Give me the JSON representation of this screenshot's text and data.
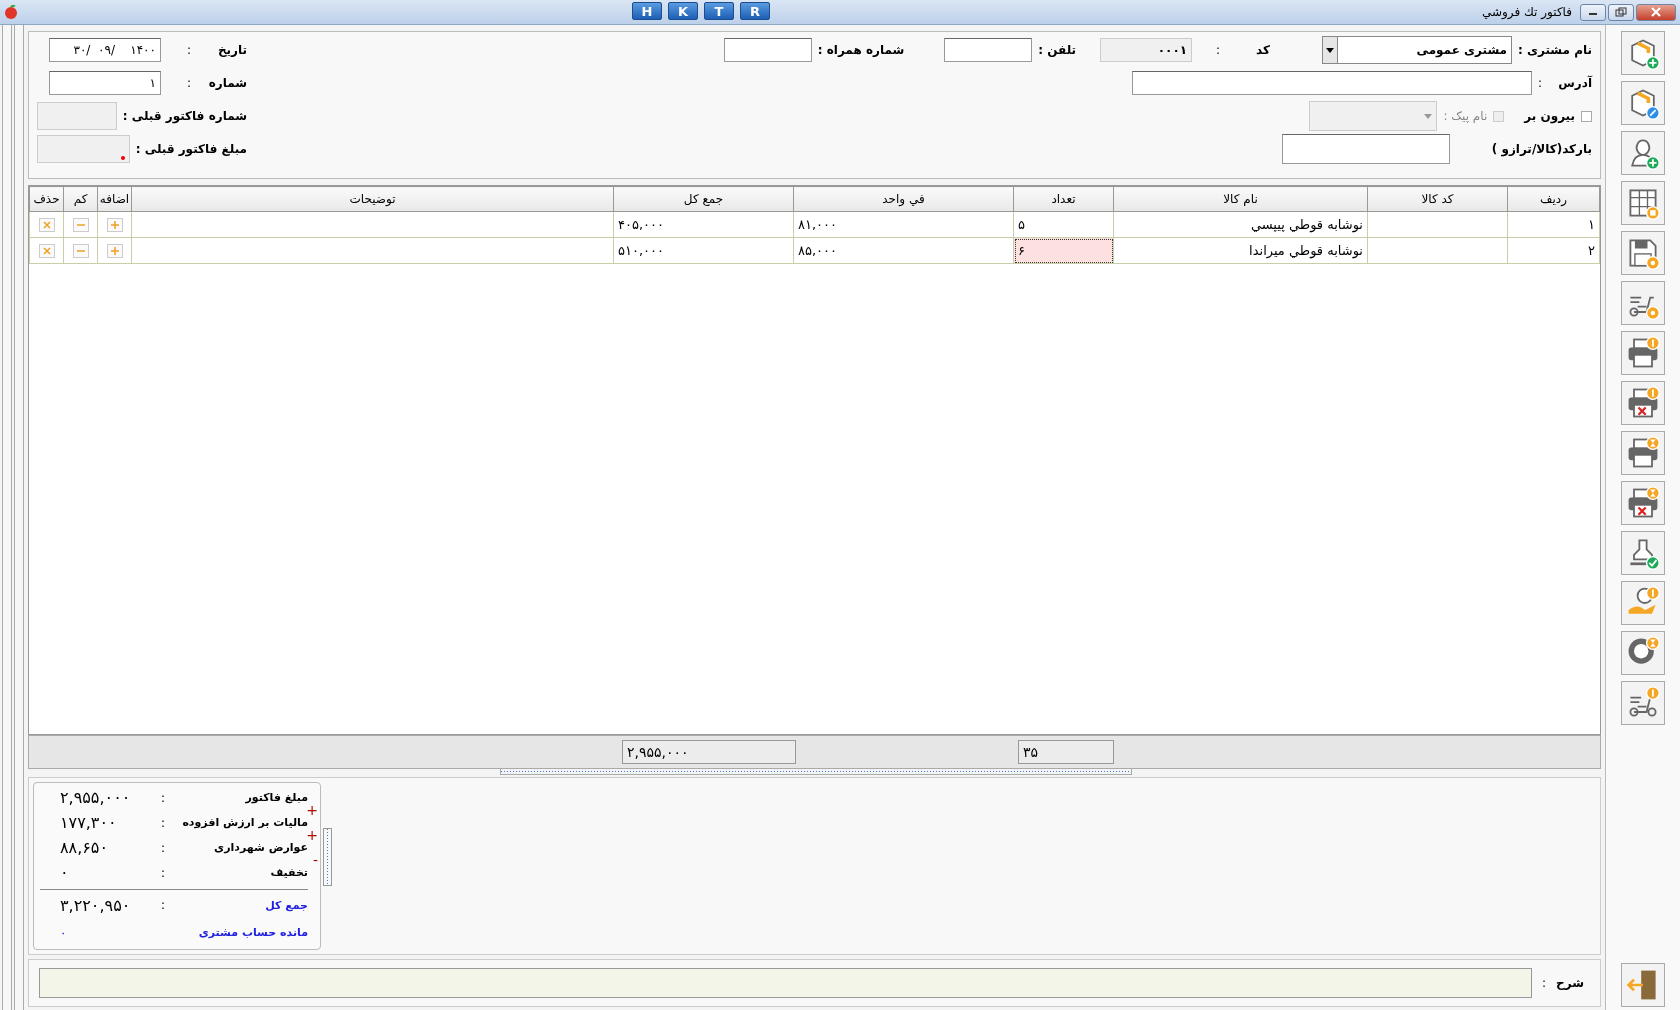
{
  "window": {
    "title": "فاکتور تك فروشي",
    "buttons": [
      "R",
      "T",
      "K",
      "H"
    ]
  },
  "form": {
    "customer": {
      "label": "نام مشتری :",
      "value": "مشتری عمومی"
    },
    "code": {
      "label": "کد",
      "colon": ":",
      "value": "۰۰۰۱"
    },
    "phone": {
      "label": "تلفن :"
    },
    "mobile": {
      "label": "شماره همراه :"
    },
    "date": {
      "label": "تاریخ",
      "colon": ":",
      "value": "۱۴۰۰    /۰۹  /۳۰"
    },
    "number": {
      "label": "شماره",
      "colon": ":",
      "value": "۱"
    },
    "address": {
      "label": "آدرس",
      "colon": ":"
    },
    "takeaway": {
      "label": "بیرون بر",
      "checked": false
    },
    "courier": {
      "label": "نام پیک :",
      "checked": false,
      "disabled": true
    },
    "prev_invoice_no": {
      "label": "شماره فاکتور قبلی :"
    },
    "prev_invoice_amount": {
      "label": "مبلغ فاکتور قبلی :"
    },
    "barcode": {
      "label": "بارکد(کالا/ترازو )"
    }
  },
  "table": {
    "columns": [
      "ردیف",
      "کد کالا",
      "نام کالا",
      "تعداد",
      "في واحد",
      "جمع کل",
      "توضیحات",
      "اضافه",
      "کم",
      "حذف"
    ],
    "rows": [
      {
        "index": "۱",
        "code": "",
        "name": "نوشابه قوطي پيپسي",
        "qty": "۵",
        "unit_price": "۸۱,۰۰۰",
        "total": "۴۰۵,۰۰۰",
        "selected": false
      },
      {
        "index": "۲",
        "code": "",
        "name": "نوشابه قوطي ميراندا",
        "qty": "۶",
        "unit_price": "۸۵,۰۰۰",
        "total": "۵۱۰,۰۰۰",
        "selected": true
      }
    ],
    "footer": {
      "qty": "۳۵",
      "total": "۲,۹۵۵,۰۰۰"
    }
  },
  "summary": [
    {
      "label": "مبلغ فاکتور",
      "colon": ":",
      "value": "۲,۹۵۵,۰۰۰",
      "kind": "line"
    },
    {
      "label": "ماليات بر ارزش افزوده",
      "colon": ":",
      "value": "۱۷۷,۳۰۰",
      "kind": "line",
      "sign": "+"
    },
    {
      "label": "عوارض شهرداری",
      "colon": ":",
      "value": "۸۸,۶۵۰",
      "kind": "line",
      "sign": "+"
    },
    {
      "label": "تخفيف",
      "colon": ":",
      "value": "۰",
      "kind": "line",
      "sign": "-"
    },
    {
      "label": "جمع کل",
      "colon": ":",
      "value": "۳,۲۲۰,۹۵۰",
      "kind": "total"
    },
    {
      "label": "مانده حساب مشتری",
      "value": "۰",
      "kind": "balance"
    }
  ],
  "note": {
    "label": "شرح",
    "colon": ":"
  }
}
